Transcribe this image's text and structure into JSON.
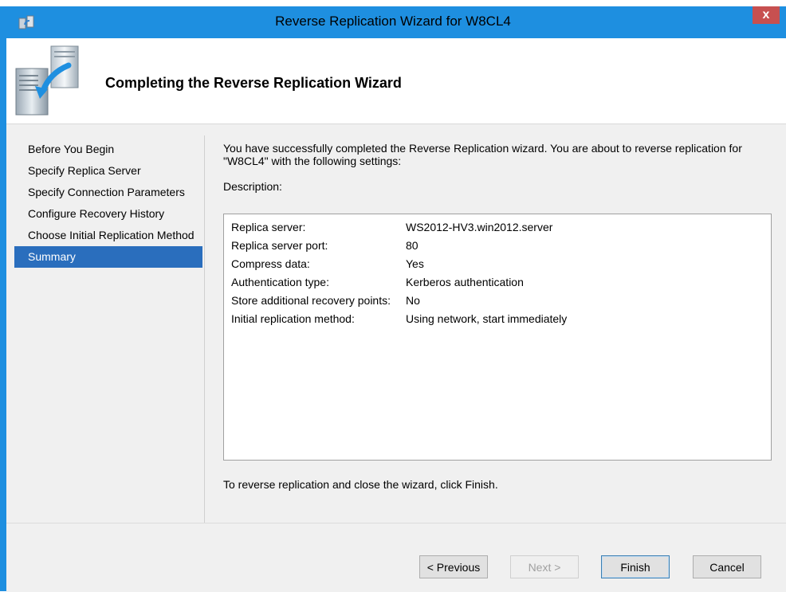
{
  "window": {
    "title": "Reverse Replication Wizard for W8CL4",
    "close_label": "x"
  },
  "header": {
    "title": "Completing the Reverse Replication Wizard",
    "icon": "server-replication-icon"
  },
  "nav": {
    "items": [
      {
        "label": "Before You Begin"
      },
      {
        "label": "Specify Replica Server"
      },
      {
        "label": "Specify Connection Parameters"
      },
      {
        "label": "Configure Recovery History"
      },
      {
        "label": "Choose Initial Replication Method"
      },
      {
        "label": "Summary"
      }
    ],
    "selected": "Summary"
  },
  "content": {
    "intro": "You have successfully completed the Reverse Replication wizard. You are about to reverse replication for \"W8CL4\" with the following settings:",
    "description_label": "Description:",
    "settings": [
      {
        "key": "Replica server:",
        "value": "WS2012-HV3.win2012.server"
      },
      {
        "key": "Replica server port:",
        "value": "80"
      },
      {
        "key": "Compress data:",
        "value": "Yes"
      },
      {
        "key": "Authentication type:",
        "value": "Kerberos authentication"
      },
      {
        "key": "Store additional recovery points:",
        "value": "No"
      },
      {
        "key": "Initial replication method:",
        "value": "Using network, start immediately"
      }
    ],
    "finish_hint": "To reverse replication and close the wizard, click Finish."
  },
  "buttons": {
    "previous": "< Previous",
    "next": "Next >",
    "finish": "Finish",
    "cancel": "Cancel"
  },
  "colors": {
    "titlebar": "#1e8fe0",
    "selection": "#2a6ebd",
    "close": "#c75050"
  }
}
